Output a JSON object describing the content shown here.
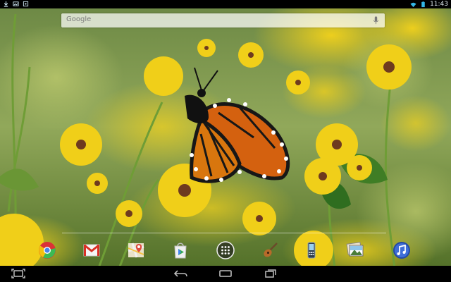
{
  "search": {
    "logo_text": "Google",
    "mic_icon": "microphone-icon"
  },
  "status_bar": {
    "time": "11:43",
    "left_icons": [
      "download-icon",
      "image-icon",
      "media-icon"
    ],
    "right_icons": [
      "wifi-icon",
      "battery-icon"
    ]
  },
  "dock": {
    "apps": [
      "chrome-icon",
      "gmail-icon",
      "maps-icon",
      "play-store-icon",
      "all-apps-icon",
      "music-guitar-icon",
      "phone-icon",
      "gallery-icon",
      "music-icon"
    ]
  },
  "navigation": {
    "buttons": [
      "back-icon",
      "home-icon",
      "recent-apps-icon",
      "screenshot-icon"
    ]
  },
  "colors": {
    "accent_blue": "#33b5e5",
    "wallpaper_green": "#6f8f3c",
    "flower_yellow": "#f2d21c",
    "butterfly_orange": "#d65a12"
  }
}
